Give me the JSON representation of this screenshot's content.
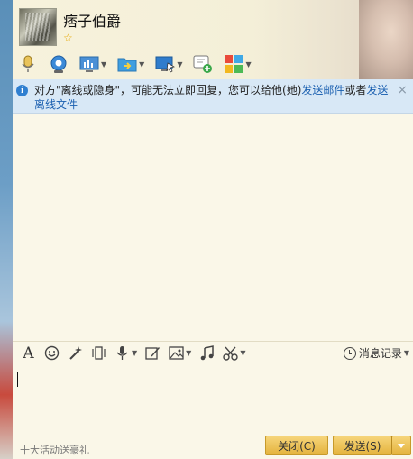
{
  "contact": {
    "name": "痞子伯爵"
  },
  "toolbar": {
    "items": [
      {
        "name": "voice-call",
        "icon": "microphone-icon",
        "dropdown": false
      },
      {
        "name": "video-call",
        "icon": "webcam-icon",
        "dropdown": false
      },
      {
        "name": "remote-assist",
        "icon": "monitor-chart-icon",
        "dropdown": true
      },
      {
        "name": "send-file",
        "icon": "folder-arrow-icon",
        "dropdown": true
      },
      {
        "name": "screen-share",
        "icon": "screen-cursor-icon",
        "dropdown": true
      },
      {
        "name": "create-discussion",
        "icon": "chat-add-icon",
        "dropdown": false
      },
      {
        "name": "apps",
        "icon": "app-grid-icon",
        "dropdown": true
      }
    ]
  },
  "notice": {
    "prefix": "对方\"离线或隐身\"，可能无法立即回复，您可以给他(她)",
    "link1": "发送邮件",
    "middle": "或者",
    "link2": "发送离线文件",
    "close": "×"
  },
  "input_toolbar": {
    "icons": [
      "font-icon",
      "emoji-icon",
      "magic-wand-icon",
      "vibrate-icon",
      "voice-message-icon",
      "doodle-icon",
      "image-icon",
      "music-icon",
      "screenshot-scissors-icon"
    ],
    "history_label": "消息记录"
  },
  "bottom": {
    "gift_link": "十大活动送豪礼",
    "close_label": "关闭(C)",
    "send_label": "发送(S)"
  },
  "colors": {
    "accent_button": "#e4b33d",
    "notice_bg": "#d8e8f6",
    "link": "#1a5fb0",
    "chat_bg": "#faf7e8"
  }
}
